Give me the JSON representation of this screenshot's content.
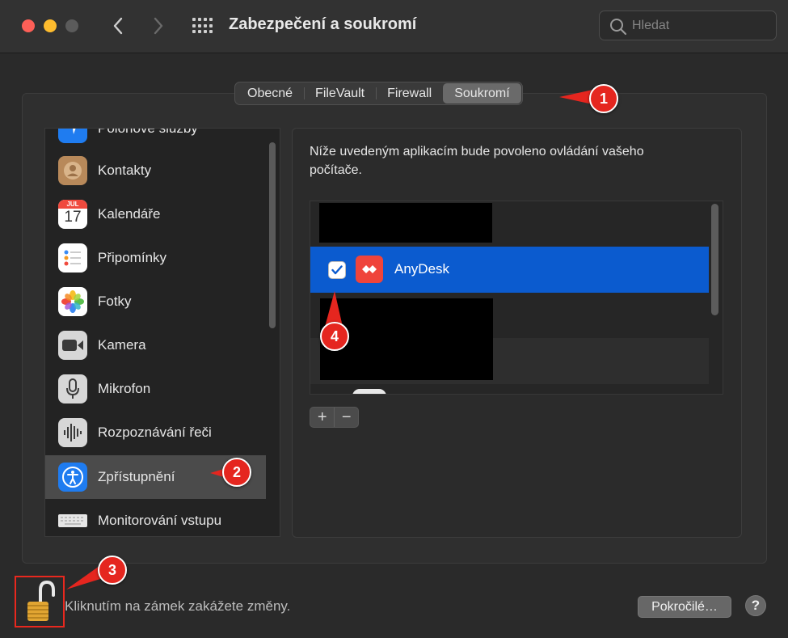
{
  "window": {
    "title": "Zabezpečení a soukromí",
    "search_placeholder": "Hledat"
  },
  "tabs": [
    {
      "label": "Obecné",
      "active": false
    },
    {
      "label": "FileVault",
      "active": false
    },
    {
      "label": "Firewall",
      "active": false
    },
    {
      "label": "Soukromí",
      "active": true
    }
  ],
  "sidebar": {
    "items": [
      {
        "label": "Polohové služby",
        "icon": "location-services-icon"
      },
      {
        "label": "Kontakty",
        "icon": "contacts-icon"
      },
      {
        "label": "Kalendáře",
        "icon": "calendar-icon",
        "calendar_month": "JUL",
        "calendar_day": "17"
      },
      {
        "label": "Připomínky",
        "icon": "reminders-icon"
      },
      {
        "label": "Fotky",
        "icon": "photos-icon"
      },
      {
        "label": "Kamera",
        "icon": "camera-icon"
      },
      {
        "label": "Mikrofon",
        "icon": "microphone-icon"
      },
      {
        "label": "Rozpoznávání řeči",
        "icon": "speech-recognition-icon"
      },
      {
        "label": "Zpřístupnění",
        "icon": "accessibility-icon",
        "selected": true
      },
      {
        "label": "Monitorování vstupu",
        "icon": "keyboard-icon"
      }
    ]
  },
  "main": {
    "description": "Níže uvedeným aplikacím bude povoleno ovládání vašeho počítače.",
    "apps": [
      {
        "name": "",
        "redacted": true
      },
      {
        "name": "AnyDesk",
        "checked": true,
        "selected": true,
        "icon": "anydesk-icon"
      },
      {
        "name": "",
        "redacted": true
      },
      {
        "name": "",
        "redacted": true
      }
    ],
    "add_label": "+",
    "remove_label": "−"
  },
  "footer": {
    "lock_text": "Kliknutím na zámek zakážete změny.",
    "advanced_label": "Pokročilé…",
    "help_label": "?"
  },
  "callouts": [
    "1",
    "2",
    "3",
    "4"
  ],
  "colors": {
    "selection_blue": "#0b5bcf",
    "callout_red": "#e5261f",
    "anydesk_red": "#ef443b"
  }
}
